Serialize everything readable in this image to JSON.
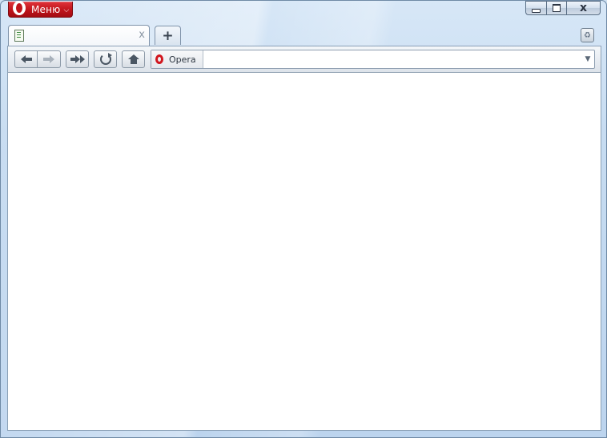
{
  "window": {
    "menu_label": "Меню",
    "menu_caret": "⌵",
    "caption": {
      "close_glyph": "x"
    }
  },
  "tabs": [
    {
      "label": "",
      "close_glyph": "x"
    }
  ],
  "new_tab_glyph": "+",
  "trash_glyph": "♻",
  "toolbar": {
    "buttons": [
      "back",
      "forward",
      "fast-forward",
      "reload",
      "home"
    ],
    "address": {
      "badge_label": "Opera",
      "value": "",
      "placeholder": "",
      "dropdown_glyph": "▼"
    }
  },
  "colors": {
    "opera_red": "#c0141b",
    "frame_blue": "#c7dcf1",
    "toolbar_bg": "#e6ebf1"
  }
}
